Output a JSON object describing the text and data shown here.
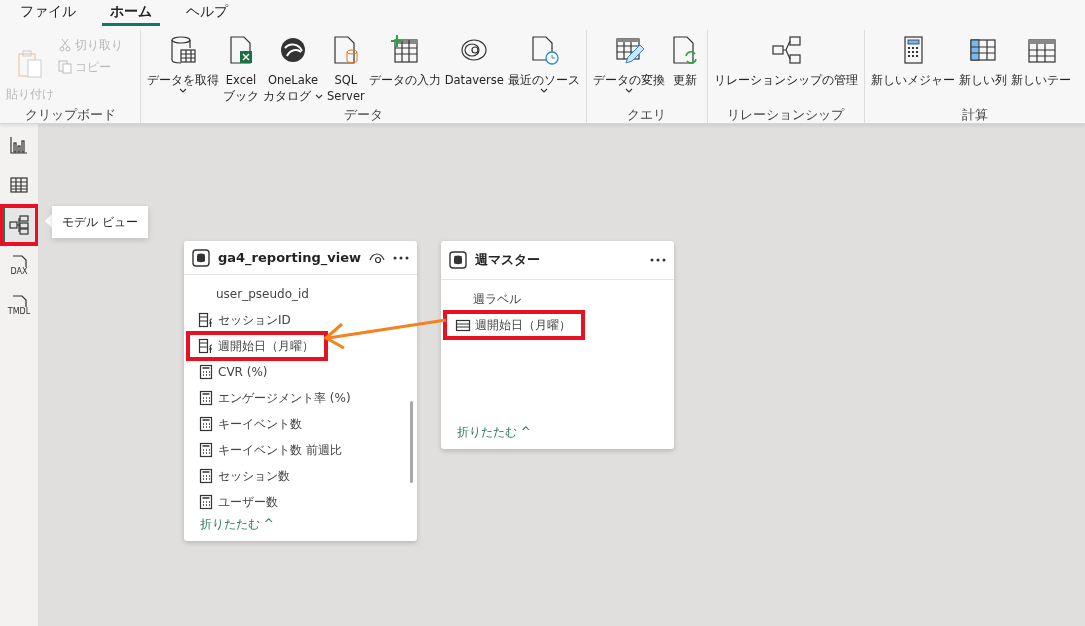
{
  "menu_tabs": [
    {
      "label": "ファイル",
      "selected": false
    },
    {
      "label": "ホーム",
      "selected": true
    },
    {
      "label": "ヘルプ",
      "selected": false
    }
  ],
  "ribbon_groups": [
    {
      "label": "クリップボード",
      "kind": "clipboard",
      "items": [
        {
          "label": "貼り付け",
          "kind": "large",
          "disabled": true
        },
        {
          "label": "切り取り",
          "kind": "small",
          "disabled": true
        },
        {
          "label": "コピー",
          "kind": "small",
          "disabled": true
        }
      ]
    },
    {
      "label": "データ",
      "kind": "normal",
      "items": [
        {
          "lines": [
            "データを取得"
          ],
          "dropdown": true
        },
        {
          "lines": [
            "Excel",
            "ブック"
          ],
          "dropdown": false
        },
        {
          "lines": [
            "OneLake",
            "カタログ"
          ],
          "dropdown": true
        },
        {
          "lines": [
            "SQL",
            "Server"
          ],
          "dropdown": false
        },
        {
          "lines": [
            "データの入力"
          ],
          "dropdown": false
        },
        {
          "lines": [
            "Dataverse"
          ],
          "dropdown": false
        },
        {
          "lines": [
            "最近のソース"
          ],
          "dropdown": true
        }
      ]
    },
    {
      "label": "クエリ",
      "kind": "normal",
      "items": [
        {
          "lines": [
            "データの変換"
          ],
          "dropdown": true
        },
        {
          "lines": [
            "更新"
          ],
          "dropdown": false
        }
      ]
    },
    {
      "label": "リレーションシップ",
      "kind": "normal",
      "items": [
        {
          "lines": [
            "リレーションシップの管理"
          ],
          "dropdown": false
        }
      ]
    },
    {
      "label": "計算",
      "kind": "normal",
      "items": [
        {
          "lines": [
            "新しいメジャー"
          ],
          "dropdown": false
        },
        {
          "lines": [
            "新しい列"
          ],
          "dropdown": false
        },
        {
          "lines": [
            "新しいテー"
          ],
          "dropdown": false
        }
      ]
    }
  ],
  "view_rail": [
    {
      "selected": false,
      "highlighted": false
    },
    {
      "selected": false,
      "highlighted": false
    },
    {
      "selected": true,
      "highlighted": true
    },
    {
      "label": "DAX",
      "selected": false,
      "highlighted": false
    },
    {
      "label": "TMDL",
      "selected": false,
      "highlighted": false
    }
  ],
  "tooltip": "モデル ビュー",
  "tables": [
    {
      "title": "ga4_reporting_view",
      "fields": [
        {
          "name": "user_pseudo_id",
          "kind": "plain",
          "highlighted": false
        },
        {
          "name": "セッションID",
          "kind": "calculated",
          "highlighted": false
        },
        {
          "name": "週開始日（月曜）",
          "kind": "calculated",
          "highlighted": true
        },
        {
          "name": "CVR (%)",
          "kind": "measure",
          "highlighted": false
        },
        {
          "name": "エンゲージメント率 (%)",
          "kind": "measure",
          "highlighted": false
        },
        {
          "name": "キーイベント数",
          "kind": "measure",
          "highlighted": false
        },
        {
          "name": "キーイベント数 前週比",
          "kind": "measure",
          "highlighted": false
        },
        {
          "name": "セッション数",
          "kind": "measure",
          "highlighted": false
        },
        {
          "name": "ユーザー数",
          "kind": "measure",
          "highlighted": false
        }
      ],
      "collapse": "折りたたむ ^"
    },
    {
      "title": "週マスター",
      "fields": [
        {
          "name": "週ラベル",
          "kind": "plain",
          "highlighted": false
        },
        {
          "name": "週開始日（月曜）",
          "kind": "column",
          "highlighted": true
        }
      ],
      "collapse": "折りたたむ ^"
    }
  ]
}
